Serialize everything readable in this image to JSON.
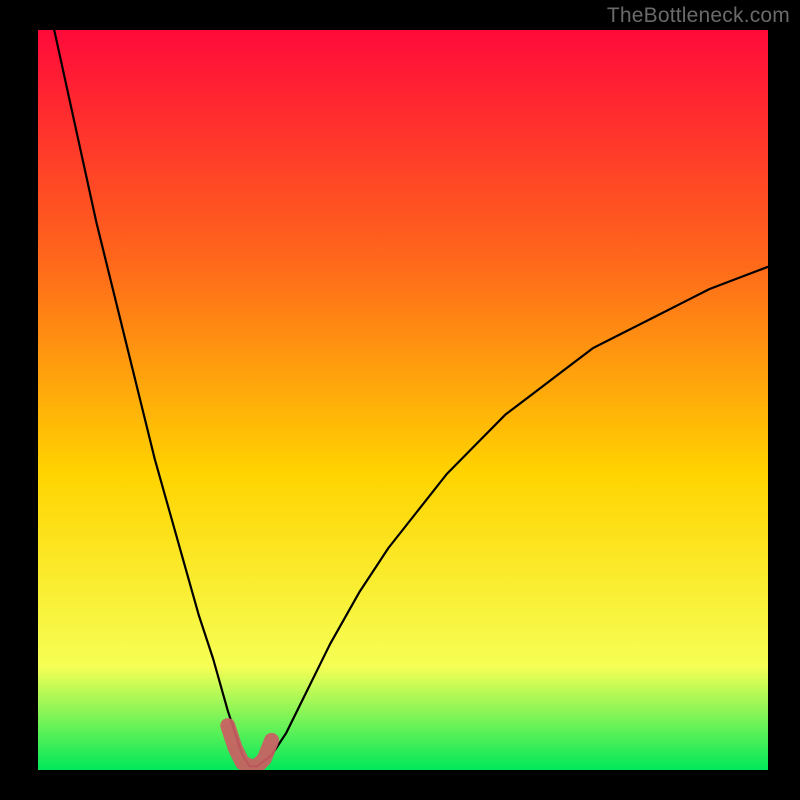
{
  "watermark": "TheBottleneck.com",
  "colors": {
    "page_bg": "#000000",
    "watermark": "#6a6a6a",
    "gradient_top": "#ff0a3a",
    "gradient_mid1": "#ff6a1a",
    "gradient_mid2": "#ffd400",
    "gradient_mid3": "#f6ff55",
    "gradient_bottom": "#00e85a",
    "curve": "#000000",
    "marker": "#cc5d63"
  },
  "chart_data": {
    "type": "line",
    "title": "",
    "xlabel": "",
    "ylabel": "",
    "xlim": [
      0,
      100
    ],
    "ylim": [
      0,
      100
    ],
    "grid": false,
    "legend": false,
    "annotations": [
      "TheBottleneck.com"
    ],
    "series": [
      {
        "name": "bottleneck-curve",
        "x": [
          0,
          2,
          4,
          6,
          8,
          10,
          12,
          14,
          16,
          18,
          20,
          22,
          24,
          26,
          27,
          28,
          29,
          30,
          32,
          34,
          36,
          38,
          40,
          44,
          48,
          52,
          56,
          60,
          64,
          68,
          72,
          76,
          80,
          84,
          88,
          92,
          96,
          100
        ],
        "y": [
          110,
          101,
          92,
          83,
          74,
          66,
          58,
          50,
          42,
          35,
          28,
          21,
          15,
          8,
          5,
          2,
          0.5,
          0.5,
          2,
          5,
          9,
          13,
          17,
          24,
          30,
          35,
          40,
          44,
          48,
          51,
          54,
          57,
          59,
          61,
          63,
          65,
          66.5,
          68
        ]
      },
      {
        "name": "minimum-marker",
        "x": [
          26,
          27,
          28,
          29,
          30,
          31,
          32
        ],
        "y": [
          6,
          3,
          1,
          0.5,
          0.5,
          1.5,
          4
        ]
      }
    ]
  }
}
